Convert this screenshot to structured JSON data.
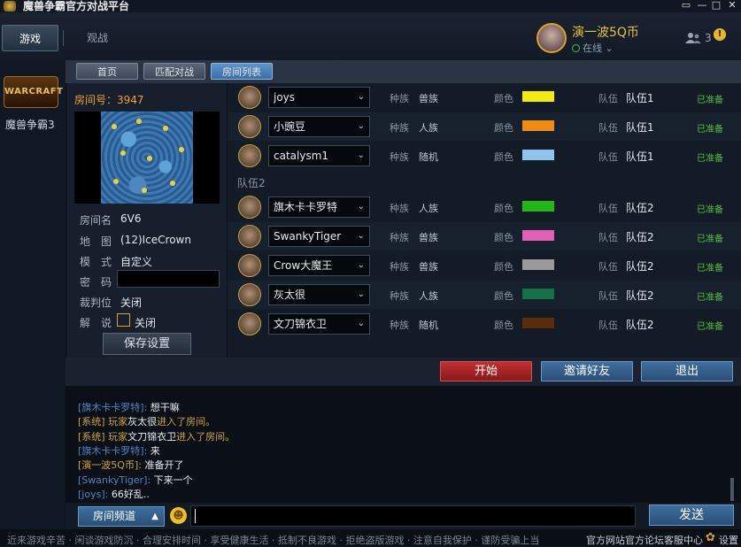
{
  "app": {
    "title": "魔兽争霸官方对战平台"
  },
  "window": {
    "restore": "▭",
    "minimize": "—",
    "maximize": "□",
    "close": "✕"
  },
  "topnav": {
    "tabs": [
      "游戏",
      "观战"
    ]
  },
  "user": {
    "name": "演一波5Q币",
    "status": "在线 ⌄",
    "friends_count": "3",
    "alert": "!"
  },
  "sidebar": {
    "logo_text": "WARCRAFT",
    "game": "魔兽争霸3"
  },
  "subtabs": [
    "首页",
    "匹配对战",
    "房间列表"
  ],
  "room": {
    "number_label": "房间号：3947",
    "fields": [
      {
        "label": "房间名",
        "value": "6V6"
      },
      {
        "label": "地　图",
        "value": "(12)IceCrown"
      },
      {
        "label": "模　式",
        "value": "自定义"
      },
      {
        "label": "密　码",
        "value": ""
      },
      {
        "label": "裁判位",
        "value": "关闭"
      },
      {
        "label": "解　说",
        "value": "关闭"
      }
    ],
    "save_label": "保存设置"
  },
  "players_labels": {
    "race": "种族",
    "color": "颜色",
    "team": "队伍",
    "team2_header": "队伍2"
  },
  "players": [
    {
      "name": "joys",
      "race": "兽族",
      "color": "#f4ea10",
      "team": "队伍1",
      "ready": "已准备"
    },
    {
      "name": "小豌豆",
      "race": "人族",
      "color": "#f08a10",
      "team": "队伍1",
      "ready": "已准备"
    },
    {
      "name": "catalysm1",
      "race": "随机",
      "color": "#8ec4ee",
      "team": "队伍1",
      "ready": "已准备"
    },
    {
      "name": "旗木卡卡罗特",
      "race": "人族",
      "color": "#22b818",
      "team": "队伍2",
      "ready": "已准备"
    },
    {
      "name": "SwankyTiger",
      "race": "兽族",
      "color": "#e060b8",
      "team": "队伍2",
      "ready": "已准备"
    },
    {
      "name": "Crow大魔王",
      "race": "兽族",
      "color": "#9a9a9a",
      "team": "队伍2",
      "ready": "已准备"
    },
    {
      "name": "灰太很",
      "race": "人族",
      "color": "#167048",
      "team": "队伍2",
      "ready": "已准备"
    },
    {
      "name": "文刀锦衣卫",
      "race": "随机",
      "color": "#5a2c08",
      "team": "队伍2",
      "ready": "已准备"
    }
  ],
  "actions": {
    "start": "开始",
    "invite": "邀请好友",
    "exit": "退出"
  },
  "chat": [
    {
      "sender": "[旗木卡卡罗特]:",
      "text": " 想干嘛"
    },
    {
      "system": "[系统] 玩家",
      "name": "灰太很",
      "text": "进入了房间。"
    },
    {
      "system": "[系统] 玩家",
      "name": "文刀锦衣卫",
      "text": "进入了房间。"
    },
    {
      "sender": "[旗木卡卡罗特]:",
      "text": " 来"
    },
    {
      "sender": "[演一波5Q币]:",
      "text": " 准备开了",
      "highlight": true
    },
    {
      "sender": "[SwankyTiger]:",
      "text": " 下来一个"
    },
    {
      "sender": "[joys]:",
      "text": " 66好乱.."
    }
  ],
  "chat_input": {
    "channel": "房间频道",
    "channel_arrow": "▲",
    "emoji": "☻",
    "send": "发送"
  },
  "footer": {
    "ticker": "近来游戏辛苦 · 闲谈游戏防沉 · 合理安排时间 · 享受健康生活 · 抵制不良游戏 · 拒绝盗版游戏 · 注意自我保护 · 谨防受骗上当",
    "links": [
      "官方网站",
      "官方论坛",
      "客服中心"
    ],
    "settings_icon": "✿",
    "settings": "设置"
  }
}
